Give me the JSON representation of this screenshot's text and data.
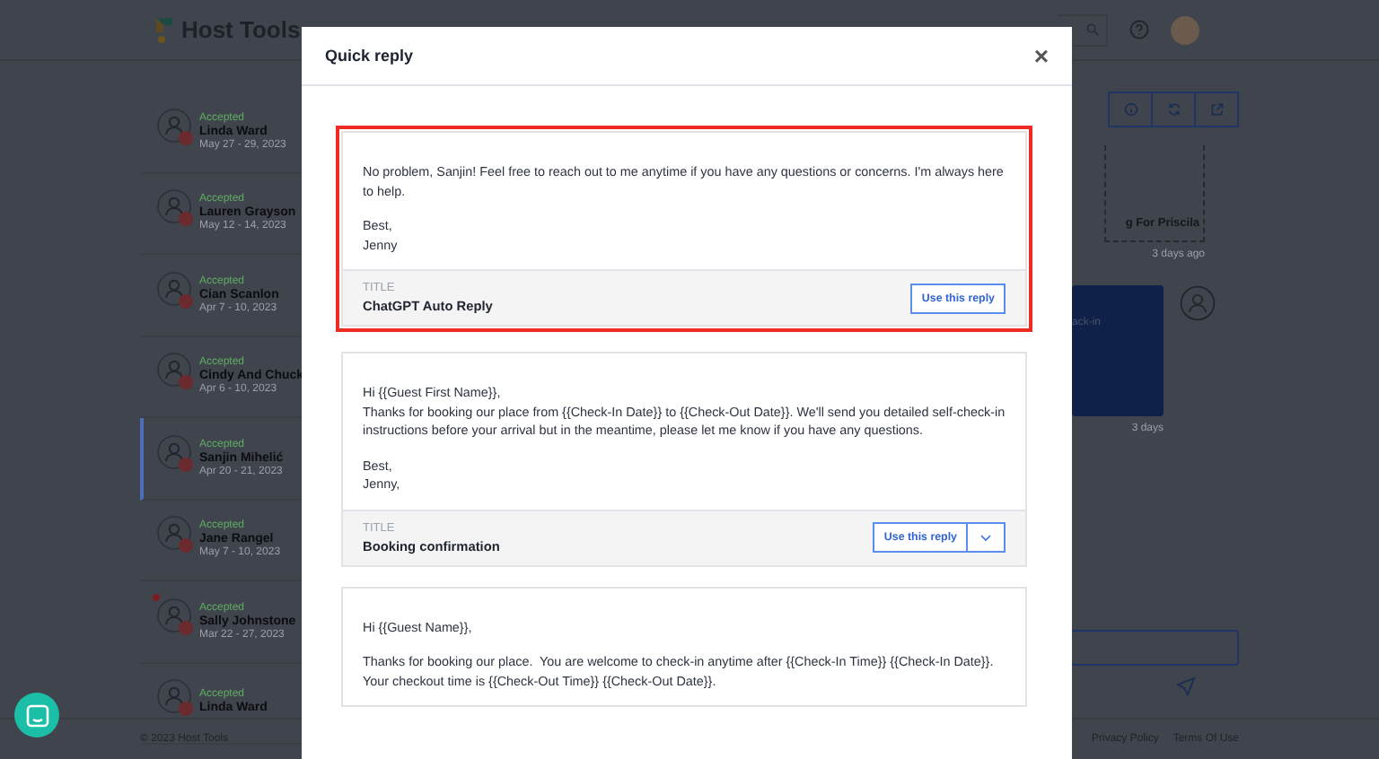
{
  "app": {
    "logo": "Host Tools",
    "footer": "© 2023 Host Tools",
    "footer_links": [
      "Privacy Policy",
      "Terms Of Use"
    ]
  },
  "conversations": [
    {
      "status": "Accepted",
      "name": "Linda Ward",
      "dates": "May 27 - 29, 2023",
      "selected": false,
      "unread": false
    },
    {
      "status": "Accepted",
      "name": "Lauren Grayson",
      "dates": "May 12 - 14, 2023",
      "selected": false,
      "unread": false
    },
    {
      "status": "Accepted",
      "name": "Cian Scanlon",
      "dates": "Apr 7 - 10, 2023",
      "selected": false,
      "unread": false
    },
    {
      "status": "Accepted",
      "name": "Cindy And Chuck",
      "dates": "Apr 6 - 10, 2023",
      "selected": false,
      "unread": false
    },
    {
      "status": "Accepted",
      "name": "Sanjin Mihelić",
      "dates": "Apr 20 - 21, 2023",
      "selected": true,
      "unread": false
    },
    {
      "status": "Accepted",
      "name": "Jane Rangel",
      "dates": "May 7 - 10, 2023",
      "selected": false,
      "unread": false
    },
    {
      "status": "Accepted",
      "name": "Sally Johnstone",
      "dates": "Mar 22 - 27, 2023",
      "selected": false,
      "unread": true
    },
    {
      "status": "Accepted",
      "name": "Linda Ward",
      "selected": false,
      "unread": false
    }
  ],
  "thread": {
    "messages": [
      {
        "kind": "note",
        "text": "g For Priscila",
        "time": "3 days ago"
      },
      {
        "kind": "sent",
        "text": "ack-in",
        "time": "3 days"
      }
    ]
  },
  "modal": {
    "title": "Quick reply",
    "close": "×",
    "replies": [
      {
        "highlighted": true,
        "body": [
          "No problem, Sanjin! Feel free to reach out to me anytime if you have any questions or concerns. I'm always here to help.",
          "Best,\nJenny"
        ],
        "title_label": "TITLE",
        "title": "ChatGPT Auto Reply",
        "button": "Use this reply",
        "dropdown": false
      },
      {
        "highlighted": false,
        "body": [
          "Hi {{Guest First Name}},\nThanks for booking our place from {{Check-In Date}} to {{Check-Out Date}}. We'll send you detailed self-check-in instructions before your arrival but in the meantime, please let me know if you have any questions.",
          "Best,\nJenny,"
        ],
        "title_label": "TITLE",
        "title": "Booking confirmation",
        "button": "Use this reply",
        "dropdown": true
      },
      {
        "highlighted": false,
        "body": [
          "Hi {{Guest Name}},",
          "Thanks for booking our place.  You are welcome to check-in anytime after {{Check-In Time}} {{Check-In Date}}.  Your checkout time is {{Check-Out Time}} {{Check-Out Date}}."
        ]
      }
    ]
  }
}
